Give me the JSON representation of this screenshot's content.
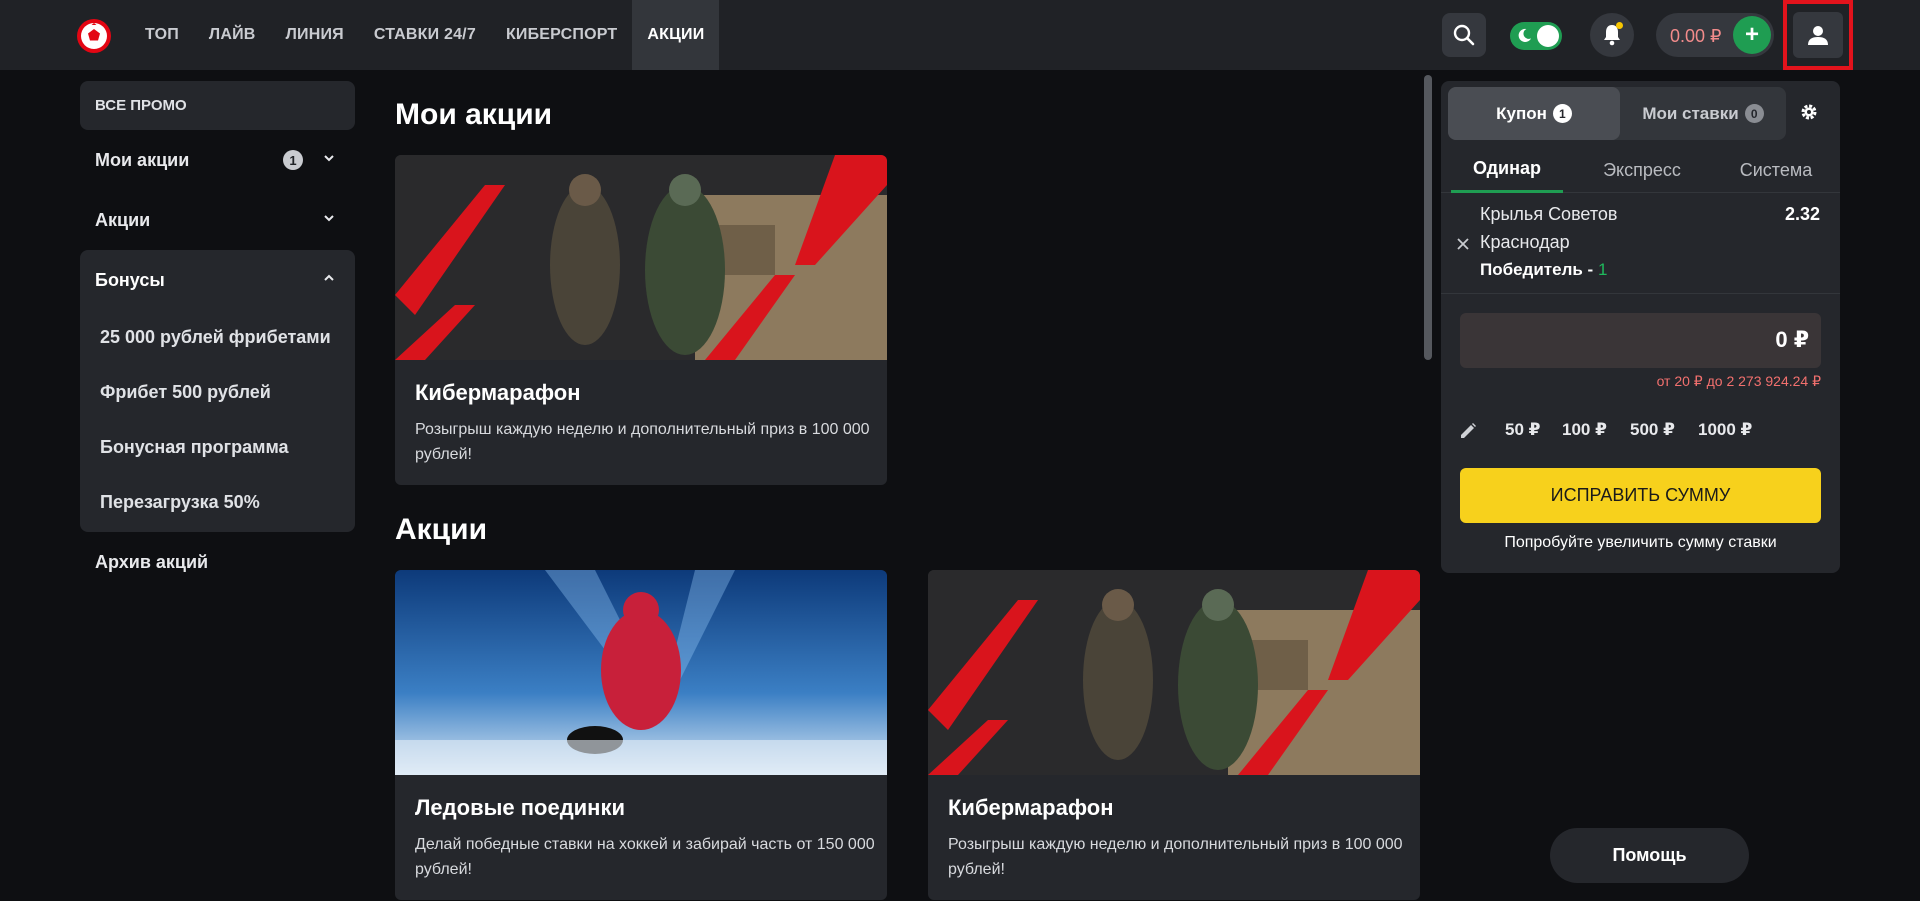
{
  "header": {
    "nav": [
      "ТОП",
      "ЛАЙВ",
      "ЛИНИЯ",
      "СТАВКИ 24/7",
      "КИБЕРСПОРТ",
      "АКЦИИ"
    ],
    "active_nav": "АКЦИИ",
    "balance": "0.00 ₽",
    "plus_label": "+",
    "icons": [
      "logo-icon",
      "search-icon",
      "moon-icon",
      "bell-icon",
      "user-icon"
    ]
  },
  "sidebar": {
    "all_promo": "ВСЕ ПРОМО",
    "my_promos": "Мои акции",
    "my_promos_count": "1",
    "promos": "Акции",
    "bonuses": "Бонусы",
    "bonus_items": [
      "25 000 рублей фрибетами",
      "Фрибет 500 рублей",
      "Бонусная программа",
      "Перезагрузка 50%"
    ],
    "archive": "Архив акций"
  },
  "main": {
    "my_promos_title": "Мои акции",
    "promos_title": "Акции",
    "cards": [
      {
        "title": "Кибермарафон",
        "desc": "Розыгрыш каждую неделю и дополнительный приз в 100 000 рублей!"
      },
      {
        "title": "Ледовые поединки",
        "desc": "Делай победные ставки на хоккей и забирай часть от 150 000 рублей!"
      },
      {
        "title": "Кибермарафон",
        "desc": "Розыгрыш каждую неделю и дополнительный приз в 100 000 рублей!"
      }
    ]
  },
  "coupon": {
    "tab_coupon": "Купон",
    "tab_coupon_count": "1",
    "tab_my_bets": "Мои ставки",
    "tab_my_bets_count": "0",
    "bet_types": [
      "Одинар",
      "Экспресс",
      "Система"
    ],
    "team1": "Крылья Советов",
    "team2": "Краснодар",
    "market": "Победитель - ",
    "outcome": "1",
    "odds": "2.32",
    "amount": "0 ₽",
    "limits": "от 20 ₽ до 2 273 924.24 ₽",
    "quick_amounts": [
      "50 ₽",
      "100 ₽",
      "500 ₽",
      "1000 ₽"
    ],
    "fix_button": "ИСПРАВИТЬ СУММУ",
    "hint": "Попробуйте увеличить сумму ставки"
  },
  "help": "Помощь",
  "colors": {
    "accent_green": "#1f9d52",
    "accent_yellow": "#f7d11c",
    "brand_red": "#e30613"
  }
}
